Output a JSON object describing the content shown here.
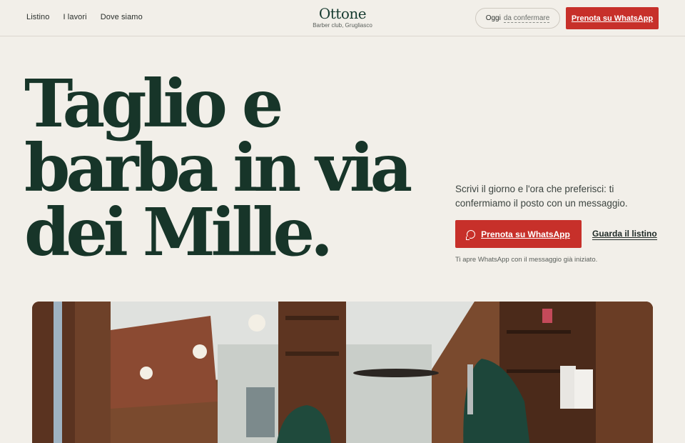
{
  "nav": {
    "items": [
      {
        "label": "Listino"
      },
      {
        "label": "I lavori"
      },
      {
        "label": "Dove siamo"
      }
    ]
  },
  "brand": {
    "name": "Ottone",
    "subtitle": "Barber club, Grugliasco"
  },
  "status": {
    "prefix": "Oggi",
    "value": "da confermare"
  },
  "header_cta": {
    "label": "Prenota su WhatsApp"
  },
  "hero": {
    "title_lines": [
      "Taglio e",
      "barba in via",
      "dei Mille."
    ],
    "lede": "Scrivi il giorno e l'ora che preferisci: ti confermiamo il posto con un messaggio.",
    "cta_label": "Prenota su WhatsApp",
    "secondary_link": "Guarda il listino",
    "note": "Ti apre WhatsApp con il messaggio già iniziato."
  },
  "colors": {
    "background": "#f2efe9",
    "brand_green": "#173529",
    "accent_red": "#c7302a"
  },
  "icons": {
    "cta_icon": "chat-bubble-icon"
  }
}
